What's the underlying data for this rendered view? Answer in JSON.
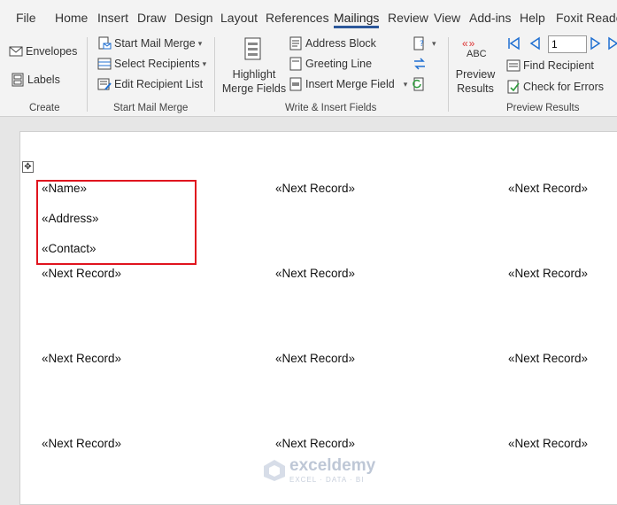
{
  "menu": {
    "tabs": [
      "File",
      "Home",
      "Insert",
      "Draw",
      "Design",
      "Layout",
      "References",
      "Mailings",
      "Review",
      "View",
      "Add-ins",
      "Help",
      "Foxit Reade"
    ],
    "active_tab": "Mailings"
  },
  "ribbon": {
    "create": {
      "label": "Create",
      "envelopes": "Envelopes",
      "labels": "Labels"
    },
    "start_mail_merge": {
      "label": "Start Mail Merge",
      "start": "Start Mail Merge",
      "select_recipients": "Select Recipients",
      "edit_list": "Edit Recipient List"
    },
    "write_insert": {
      "label": "Write & Insert Fields",
      "highlight_line1": "Highlight",
      "highlight_line2": "Merge Fields",
      "address_block": "Address Block",
      "greeting_line": "Greeting Line",
      "insert_merge_field": "Insert Merge Field"
    },
    "preview": {
      "label": "Preview Results",
      "abc": "ABC",
      "preview_line1": "Preview",
      "preview_line2": "Results",
      "record_value": "1",
      "find_recipient": "Find Recipient",
      "check_errors": "Check for Errors"
    }
  },
  "document": {
    "name_field": "«Name»",
    "address_field": "«Address»",
    "contact_field": "«Contact»",
    "next_record": "«Next Record»"
  },
  "watermark": {
    "name": "exceldemy",
    "sub": "EXCEL · DATA · BI"
  },
  "colors": {
    "accent": "#2b579a",
    "highlight_border": "#e0141e",
    "nav_blue": "#1f6fd1"
  }
}
